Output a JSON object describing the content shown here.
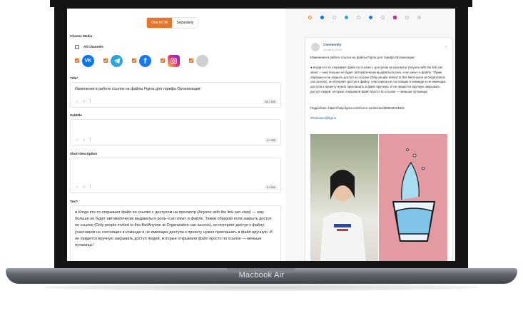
{
  "device": {
    "label": "Macbook Air"
  },
  "editor": {
    "mode_toggle": {
      "one_for_all": "One for All",
      "separately": "Separately"
    },
    "choose_media_label": "Choose Media",
    "all_channels_label": "All Channels",
    "title": {
      "label": "Title*",
      "value": "Изменения в работе ссылок на файлы Figma для тарифа Организации:",
      "counter": "54 / 100"
    },
    "subtitle": {
      "label": "Subtitle",
      "value": "",
      "counter": "0 / 250"
    },
    "short_description": {
      "label": "Short description",
      "value": "",
      "counter": "0 / 500"
    },
    "text": {
      "label": "Text*",
      "value": "● Когда кто-то открывает файл по ссылке с доступом на просмотр (Anyone with the link can view) — ему больше не будет автоматически выдаваться роль «can view» в файле. Таким образом если закрыть доступ по ссылке (Only people invited to this file/Anyone at Organization can access), он потеряет доступ к файлу: участников не состоящих в команде и не имеющих доступа к проекту нужно приглашать в файл вручную. И не придется вручную закрывать доступ людей, которые открывали файл просто по ссылке — меньше путаницы!"
    },
    "tool_icons": [
      "emoji-icon",
      "hashtag-icon",
      "text-format-icon"
    ]
  },
  "preview": {
    "community_name": "Community",
    "date": "10 авг в 14:03",
    "post_title": "Изменения в работе ссылок на файлы Figma для тарифа Организации:",
    "post_body": "● Когда кто-то открывает файл по ссылке с доступом на просмотр (Anyone with the link can view) — ему больше не будет автоматически выдаваться роль «can view» в файле. Таким образом если закрыть доступ по ссылке (Only people invited to this file/Anyone at Organization can access), он потеряет доступ к файлу: участников не состоящих в команде и не имеющих доступа к проекту нужно приглашать в файл вручную. И не придется вручную закрывать доступ людей, которые открывали файл просто по ссылке — меньше путаницы!",
    "more_link": "Подробнее: https://help.figma.com/hc/en-us/articles/360040044834",
    "hashtag": "#Releases@figma"
  },
  "colors": {
    "accent": "#e8742a",
    "vk": "#0077ff",
    "telegram": "#2aa3dd",
    "facebook": "#1877f2",
    "instagram": "#d62976"
  }
}
